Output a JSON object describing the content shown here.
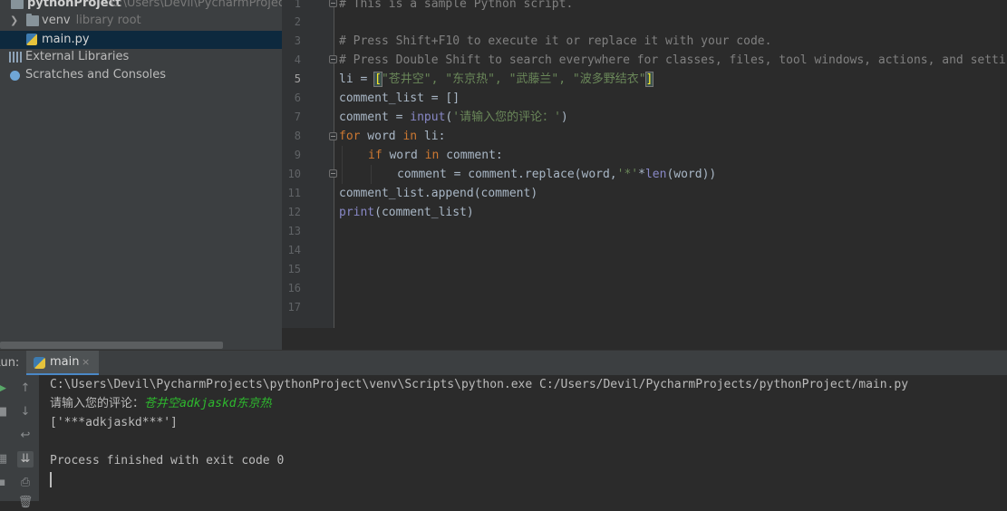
{
  "project": {
    "root_name": "pythonProject",
    "root_path": "C:\\Users\\Devil\\PycharmProjects\\pythonProject",
    "items": [
      {
        "label": "venv",
        "hint": "library root",
        "icon": "folder-icon"
      },
      {
        "label": "main.py",
        "icon": "python-file-icon",
        "selected": true
      },
      {
        "label": "External Libraries",
        "icon": "library-icon"
      },
      {
        "label": "Scratches and Consoles",
        "icon": "scratches-icon"
      }
    ]
  },
  "editor": {
    "current_line": 5,
    "line_numbers": [
      "1",
      "2",
      "3",
      "4",
      "5",
      "6",
      "7",
      "8",
      "9",
      "10",
      "11",
      "12",
      "13",
      "14",
      "15",
      "16",
      "17"
    ],
    "lines": {
      "l1": "# This is a sample Python script.",
      "l3": "# Press Shift+F10 to execute it or replace it with your code.",
      "l4": "# Press Double Shift to search everywhere for classes, files, tool windows, actions, and settings.",
      "l5_var": "li = ",
      "l5_open": "[",
      "l5_items": "\"苍井空\", \"东京热\", \"武藤兰\", \"波多野结衣\"",
      "l5_close": "]",
      "l6": "comment_list = []",
      "l7_a": "comment = ",
      "l7_fn": "input",
      "l7_b": "(",
      "l7_str": "'请输入您的评论：'",
      "l7_c": ")",
      "l8_kw": "for",
      "l8_a": " word ",
      "l8_in": "in",
      "l8_b": " li:",
      "l9_kw": "if",
      "l9_a": " word ",
      "l9_in": "in",
      "l9_b": " comment:",
      "l10_a": "comment = comment.replace(word,",
      "l10_str": "'*'",
      "l10_b": "*",
      "l10_fn": "len",
      "l10_c": "(word))",
      "l11": "comment_list.append(comment)",
      "l12_fn": "print",
      "l12_a": "(comment_list)"
    }
  },
  "run": {
    "label": "Run:",
    "tab_name": "main",
    "tab_close": "×",
    "console": {
      "command": "C:\\Users\\Devil\\PycharmProjects\\pythonProject\\venv\\Scripts\\python.exe C:/Users/Devil/PycharmProjects/pythonProject/main.py",
      "prompt": "请输入您的评论：",
      "user_input": "苍井空adkjaskd东京热",
      "result": "['***adkjaskd***']",
      "finished": "Process finished with exit code 0"
    },
    "toolbar": [
      {
        "icon": "rerun-icon",
        "glyph": "▶"
      },
      {
        "icon": "up-arrow-icon",
        "glyph": "↑"
      },
      {
        "icon": "stop-icon",
        "glyph": "■"
      },
      {
        "icon": "down-arrow-icon",
        "glyph": "↓"
      },
      {
        "icon": "soft-wrap-icon",
        "glyph": "↩"
      },
      {
        "icon": "scroll-to-end-icon",
        "glyph": "⇊"
      },
      {
        "icon": "print-icon",
        "glyph": "⎙"
      },
      {
        "icon": "delete-icon",
        "glyph": "🗑"
      }
    ]
  },
  "colors": {
    "comment": "#808080",
    "keyword": "#cc7832",
    "string": "#6a8759",
    "builtin": "#8888c6",
    "user_input": "#2eb82e",
    "selection": "#0d293e"
  }
}
